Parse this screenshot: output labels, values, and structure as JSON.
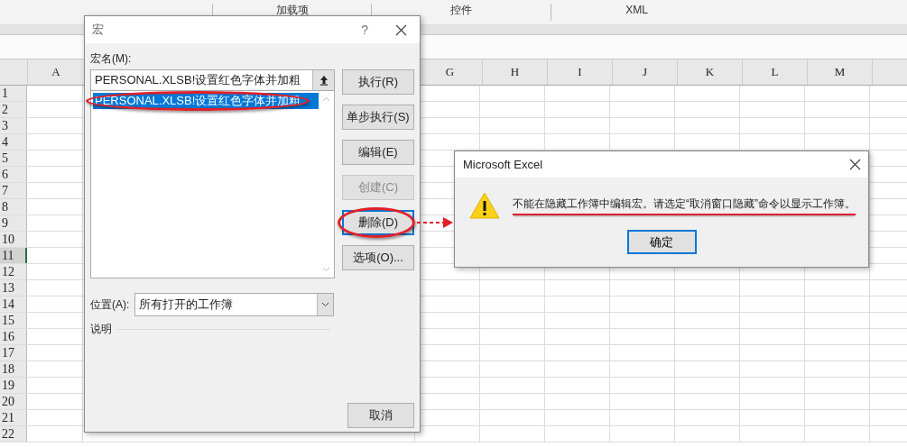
{
  "ribbon_groups": [
    "加载项",
    "控件",
    "XML"
  ],
  "sheet": {
    "columns_left": [
      "A"
    ],
    "columns_right": [
      "G",
      "H",
      "I",
      "J",
      "K",
      "L",
      "M"
    ],
    "rows": [
      {
        "label": "1",
        "selected": false
      },
      {
        "label": "2",
        "selected": false
      },
      {
        "label": "3",
        "selected": false
      },
      {
        "label": "4",
        "selected": false
      },
      {
        "label": "5",
        "selected": false
      },
      {
        "label": "6",
        "selected": false
      },
      {
        "label": "7",
        "selected": false
      },
      {
        "label": "8",
        "selected": false
      },
      {
        "label": "9",
        "selected": false
      },
      {
        "label": "10",
        "selected": false
      },
      {
        "label": "11",
        "selected": true
      },
      {
        "label": "12",
        "selected": false
      },
      {
        "label": "13",
        "selected": false
      },
      {
        "label": "14",
        "selected": false
      },
      {
        "label": "15",
        "selected": false
      },
      {
        "label": "16",
        "selected": false
      },
      {
        "label": "17",
        "selected": false
      },
      {
        "label": "18",
        "selected": false
      },
      {
        "label": "19",
        "selected": false
      },
      {
        "label": "20",
        "selected": false
      },
      {
        "label": "21",
        "selected": false
      },
      {
        "label": "22",
        "selected": false
      }
    ]
  },
  "macro_dialog": {
    "title": "宏",
    "help": "?",
    "name_label": "宏名(M):",
    "name_value": "PERSONAL.XLSB!设置红色字体并加粗",
    "macros": [
      {
        "name": "PERSONAL.XLSB!设置红色字体并加粗",
        "selected": true,
        "highlighted": true
      }
    ],
    "buttons": [
      {
        "label": "执行(R)",
        "disabled": false,
        "focused": false,
        "highlighted": false
      },
      {
        "label": "单步执行(S)",
        "disabled": false,
        "focused": false,
        "highlighted": false
      },
      {
        "label": "编辑(E)",
        "disabled": false,
        "focused": false,
        "highlighted": false
      },
      {
        "label": "创建(C)",
        "disabled": true,
        "focused": false,
        "highlighted": false
      },
      {
        "label": "删除(D)",
        "disabled": false,
        "focused": true,
        "highlighted": true
      },
      {
        "label": "选项(O)...",
        "disabled": false,
        "focused": false,
        "highlighted": false
      }
    ],
    "location_label": "位置(A):",
    "location_value": "所有打开的工作簿",
    "description_label": "说明",
    "cancel": "取消"
  },
  "message_box": {
    "title": "Microsoft Excel",
    "message": "不能在隐藏工作簿中编辑宏。请选定“取消窗口隐藏”命令以显示工作簿。",
    "underlined": true,
    "ok": "确定"
  }
}
